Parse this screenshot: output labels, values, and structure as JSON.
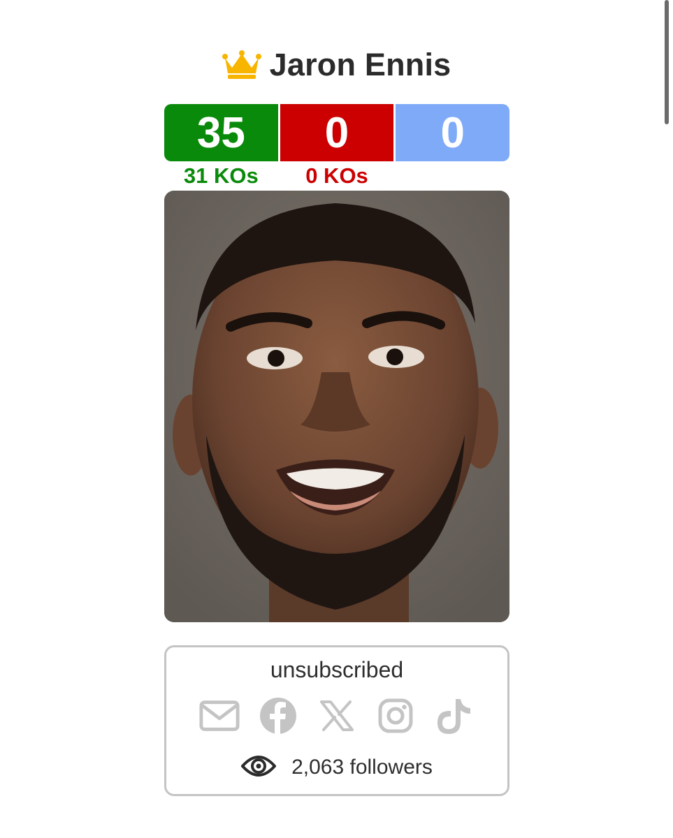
{
  "fighter": {
    "name": "Jaron Ennis",
    "crown_icon": "crown-icon"
  },
  "record": {
    "wins": "35",
    "losses": "0",
    "draws": "0",
    "win_kos": "31 KOs",
    "loss_kos": "0 KOs",
    "colors": {
      "win": "#0a8a0a",
      "loss": "#cc0000",
      "draw": "#7faaf8"
    }
  },
  "photo": {
    "icon": "fighter-portrait"
  },
  "social": {
    "status": "unsubscribed",
    "icons": [
      "email-icon",
      "facebook-icon",
      "x-icon",
      "instagram-icon",
      "tiktok-icon"
    ],
    "icon_color": "#c4c4c4",
    "followers": "2,063 followers",
    "followers_icon": "eye-icon"
  }
}
